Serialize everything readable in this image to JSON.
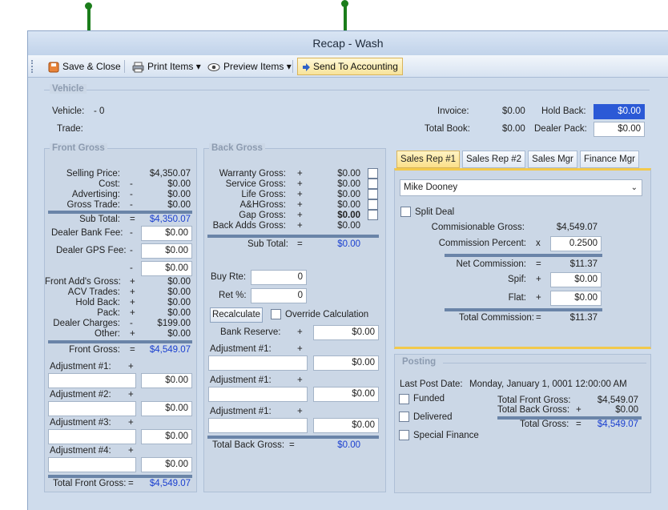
{
  "window": {
    "title": "Recap - Wash"
  },
  "toolbar": {
    "save_close": "Save & Close",
    "print_items": "Print Items",
    "preview_items": "Preview Items",
    "send_to_accounting": "Send To Accounting"
  },
  "vehicle": {
    "group_title": "Vehicle",
    "vehicle_label": "Vehicle:",
    "vehicle_value": "- 0",
    "trade_label": "Trade:",
    "invoice_label": "Invoice:",
    "invoice_value": "$0.00",
    "total_book_label": "Total Book:",
    "total_book_value": "$0.00",
    "hold_back_label": "Hold Back:",
    "hold_back_value": "$0.00",
    "dealer_pack_label": "Dealer Pack:",
    "dealer_pack_value": "$0.00"
  },
  "front": {
    "group_title": "Front Gross",
    "rows1": [
      {
        "label": "Selling Price:",
        "op": "",
        "value": "$4,350.07"
      },
      {
        "label": "Cost:",
        "op": "-",
        "value": "$0.00"
      },
      {
        "label": "Advertising:",
        "op": "-",
        "value": "$0.00"
      },
      {
        "label": "Gross Trade:",
        "op": "-",
        "value": "$0.00"
      }
    ],
    "subtotal_label": "Sub Total:",
    "subtotal_op": "=",
    "subtotal_value": "$4,350.07",
    "dealer_bank_fee_label": "Dealer Bank Fee:",
    "dealer_bank_fee_op": "-",
    "dealer_bank_fee_value": "$0.00",
    "dealer_gps_fee_label": "Dealer GPS Fee:",
    "dealer_gps_fee_op": "-",
    "dealer_gps_fee_value": "$0.00",
    "blank_op": "-",
    "blank_value": "$0.00",
    "rows2": [
      {
        "label": "Front Add's Gross:",
        "op": "+",
        "value": "$0.00"
      },
      {
        "label": "ACV Trades:",
        "op": "+",
        "value": "$0.00"
      },
      {
        "label": "Hold Back:",
        "op": "+",
        "value": "$0.00"
      },
      {
        "label": "Pack:",
        "op": "+",
        "value": "$0.00"
      },
      {
        "label": "Dealer Charges:",
        "op": "-",
        "value": "$199.00"
      },
      {
        "label": "Other:",
        "op": "+",
        "value": "$0.00"
      }
    ],
    "front_gross_label": "Front Gross:",
    "front_gross_op": "=",
    "front_gross_value": "$4,549.07",
    "adjustments": [
      {
        "label": "Adjustment #1:",
        "op": "+",
        "value": "$0.00"
      },
      {
        "label": "Adjustment #2:",
        "op": "+",
        "value": "$0.00"
      },
      {
        "label": "Adjustment #3:",
        "op": "+",
        "value": "$0.00"
      },
      {
        "label": "Adjustment #4:",
        "op": "+",
        "value": "$0.00"
      }
    ],
    "total_label": "Total Front Gross:",
    "total_op": "=",
    "total_value": "$4,549.07"
  },
  "back": {
    "group_title": "Back Gross",
    "rows": [
      {
        "label": "Warranty Gross:",
        "op": "+",
        "value": "$0.00"
      },
      {
        "label": "Service Gross:",
        "op": "+",
        "value": "$0.00"
      },
      {
        "label": "Life Gross:",
        "op": "+",
        "value": "$0.00"
      },
      {
        "label": "A&HGross:",
        "op": "+",
        "value": "$0.00"
      },
      {
        "label": "Gap Gross:",
        "op": "+",
        "value": "$0.00"
      },
      {
        "label": "Back Adds Gross:",
        "op": "+",
        "value": "$0.00"
      }
    ],
    "subtotal_label": "Sub Total:",
    "subtotal_op": "=",
    "subtotal_value": "$0.00",
    "buy_rate_label": "Buy Rte:",
    "buy_rate_value": "0",
    "ret_label": "Ret %:",
    "ret_value": "0",
    "recalculate": "Recalculate",
    "override_label": "Override Calculation",
    "bank_reserve_label": "Bank Reserve:",
    "bank_reserve_op": "+",
    "bank_reserve_value": "$0.00",
    "adjustments": [
      {
        "label": "Adjustment #1:",
        "op": "+",
        "value": "$0.00"
      },
      {
        "label": "Adjustment #1:",
        "op": "+",
        "value": "$0.00"
      },
      {
        "label": "Adjustment #1:",
        "op": "+",
        "value": "$0.00"
      }
    ],
    "total_label": "Total Back Gross:",
    "total_op": "=",
    "total_value": "$0.00"
  },
  "sales": {
    "tabs": [
      "Sales Rep #1",
      "Sales Rep #2",
      "Sales Mgr",
      "Finance Mgr"
    ],
    "rep": "Mike Dooney",
    "split_deal": "Split Deal",
    "commissionable_label": "Commisionable Gross:",
    "commissionable_value": "$4,549.07",
    "commission_percent_label": "Commission Percent:",
    "commission_percent_op": "x",
    "commission_percent_value": "0.2500",
    "net_label": "Net Commission:",
    "net_op": "=",
    "net_value": "$11.37",
    "spif_label": "Spif:",
    "spif_op": "+",
    "spif_value": "$0.00",
    "flat_label": "Flat:",
    "flat_op": "+",
    "flat_value": "$0.00",
    "total_label": "Total Commission:",
    "total_op": "=",
    "total_value": "$11.37"
  },
  "posting": {
    "group_title": "Posting",
    "last_post_label": "Last Post Date:",
    "last_post_value": "Monday, January 1, 0001 12:00:00 AM",
    "funded": "Funded",
    "delivered": "Delivered",
    "special_finance": "Special Finance",
    "total_front_label": "Total Front Gross:",
    "total_front_value": "$4,549.07",
    "total_back_label": "Total Back Gross:",
    "total_back_op": "+",
    "total_back_value": "$0.00",
    "total_gross_label": "Total Gross:",
    "total_gross_op": "=",
    "total_gross_value": "$4,549.07"
  }
}
